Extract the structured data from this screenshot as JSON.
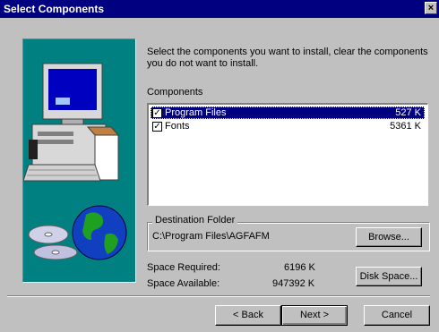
{
  "window": {
    "title": "Select Components",
    "close_label": "×"
  },
  "instructions": "Select the components you want to install, clear the components you do not want to install.",
  "components": {
    "heading": "Components",
    "items": [
      {
        "label": "Program Files",
        "size": "527 K",
        "checked": true,
        "selected": true
      },
      {
        "label": "Fonts",
        "size": "5361 K",
        "checked": true,
        "selected": false
      }
    ]
  },
  "destination": {
    "legend": "Destination Folder",
    "path": "C:\\Program Files\\AGFAFM",
    "browse_label": "Browse..."
  },
  "space": {
    "required_label": "Space Required:",
    "required_value": "6196 K",
    "available_label": "Space Available:",
    "available_value": "947392 K",
    "disk_space_label": "Disk Space..."
  },
  "buttons": {
    "back": "< Back",
    "next": "Next >",
    "cancel": "Cancel"
  },
  "colors": {
    "titlebar": "#000080",
    "face": "#c0c0c0",
    "art_bg": "#008080"
  }
}
